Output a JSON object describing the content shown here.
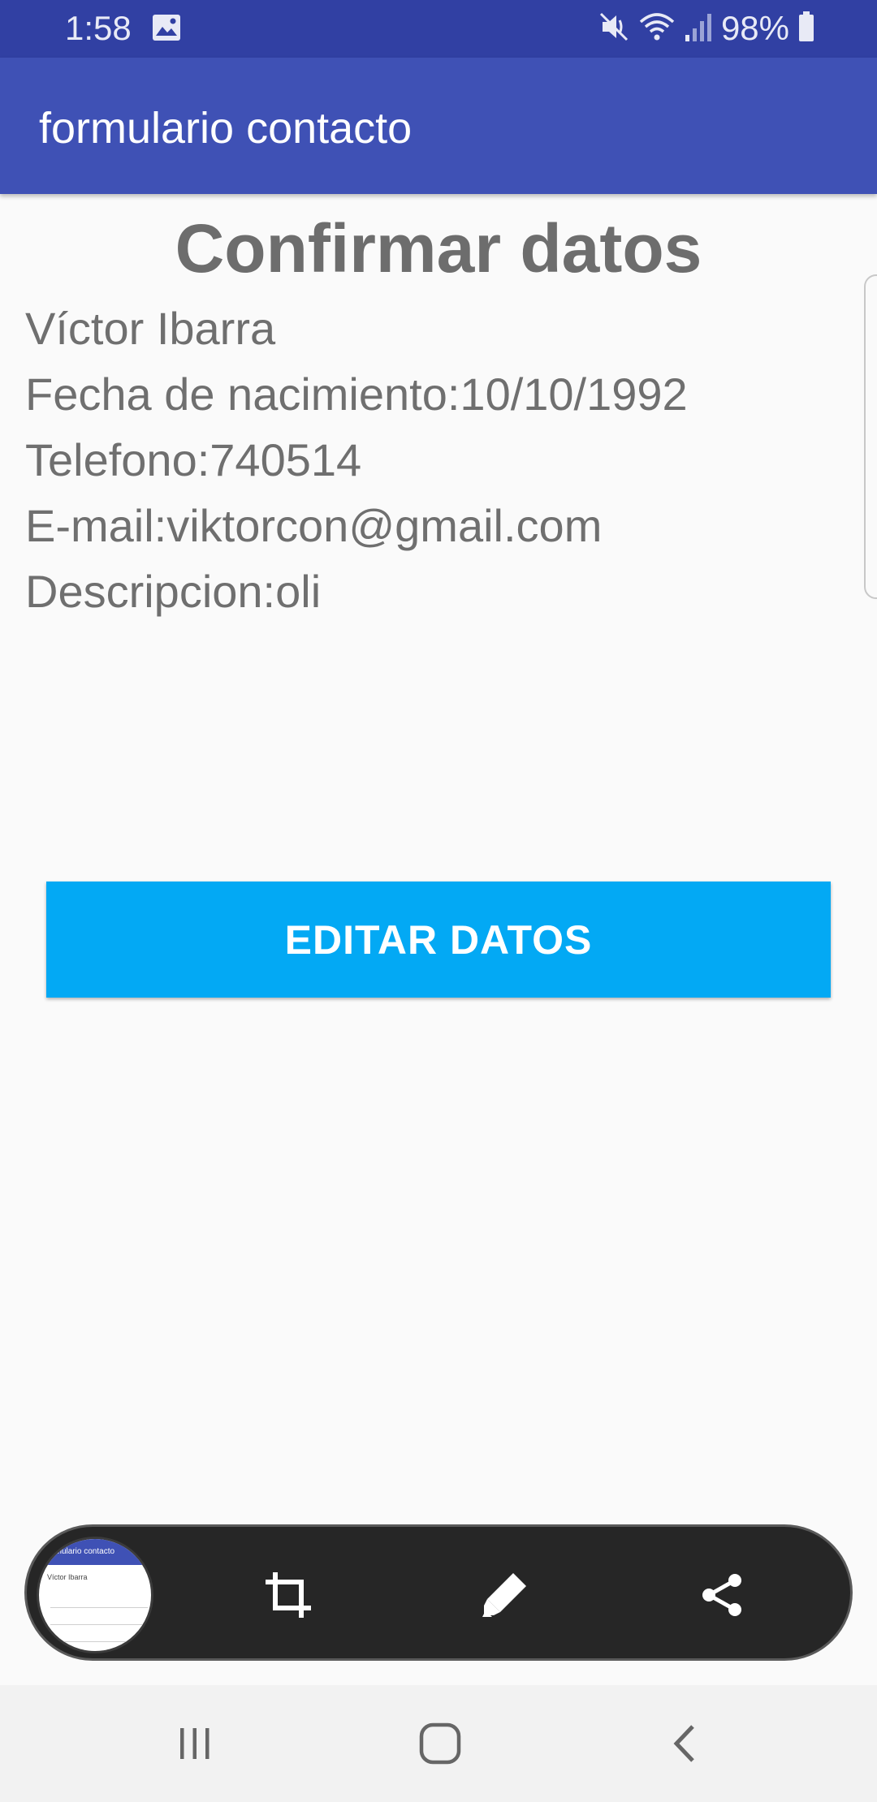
{
  "status_bar": {
    "time": "1:58",
    "battery": "98%",
    "icons": [
      "gallery-icon",
      "mute-icon",
      "wifi-icon",
      "signal-icon",
      "battery-icon"
    ]
  },
  "app_bar": {
    "title": "formulario contacto",
    "color": "#3f51b5"
  },
  "content": {
    "heading": "Confirmar datos",
    "lines": [
      "Víctor Ibarra",
      "Fecha de nacimiento:10/10/1992",
      "Telefono:740514",
      "E-mail:viktorcon@gmail.com",
      "Descripcion:oli"
    ]
  },
  "edit_button": {
    "label": "EDITAR DATOS",
    "color": "#03a9f4"
  },
  "screenshot_toolbar": {
    "thumb_title": "formulario contacto",
    "thumb_line": "Víctor Ibarra",
    "tools": [
      "crop-icon",
      "edit-pencil-icon",
      "share-icon"
    ]
  },
  "nav_bar": {
    "buttons": [
      "recents-icon",
      "home-icon",
      "back-icon"
    ]
  }
}
